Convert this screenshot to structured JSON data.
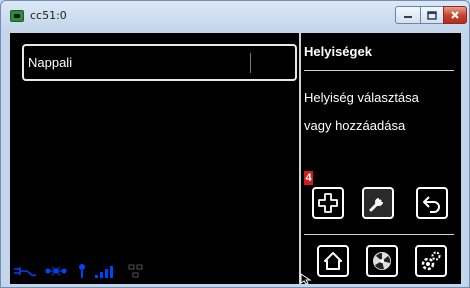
{
  "window": {
    "title": "cc51:0",
    "accent_color": "#0044ff"
  },
  "rooms": {
    "selected": "Nappali"
  },
  "panel": {
    "title": "Helyiségek",
    "description_line1": "Helyiség választása",
    "description_line2": "vagy hozzáadása",
    "badge": "4"
  },
  "buttons": {
    "row1": [
      "plus-icon",
      "wrench-icon",
      "back-icon"
    ],
    "row2": [
      "home-icon",
      "fan-icon",
      "settings-icon"
    ]
  },
  "status_icons": [
    "power-icon",
    "network-icon",
    "antenna-icon",
    "signal-bars-icon",
    "lan-icon"
  ]
}
